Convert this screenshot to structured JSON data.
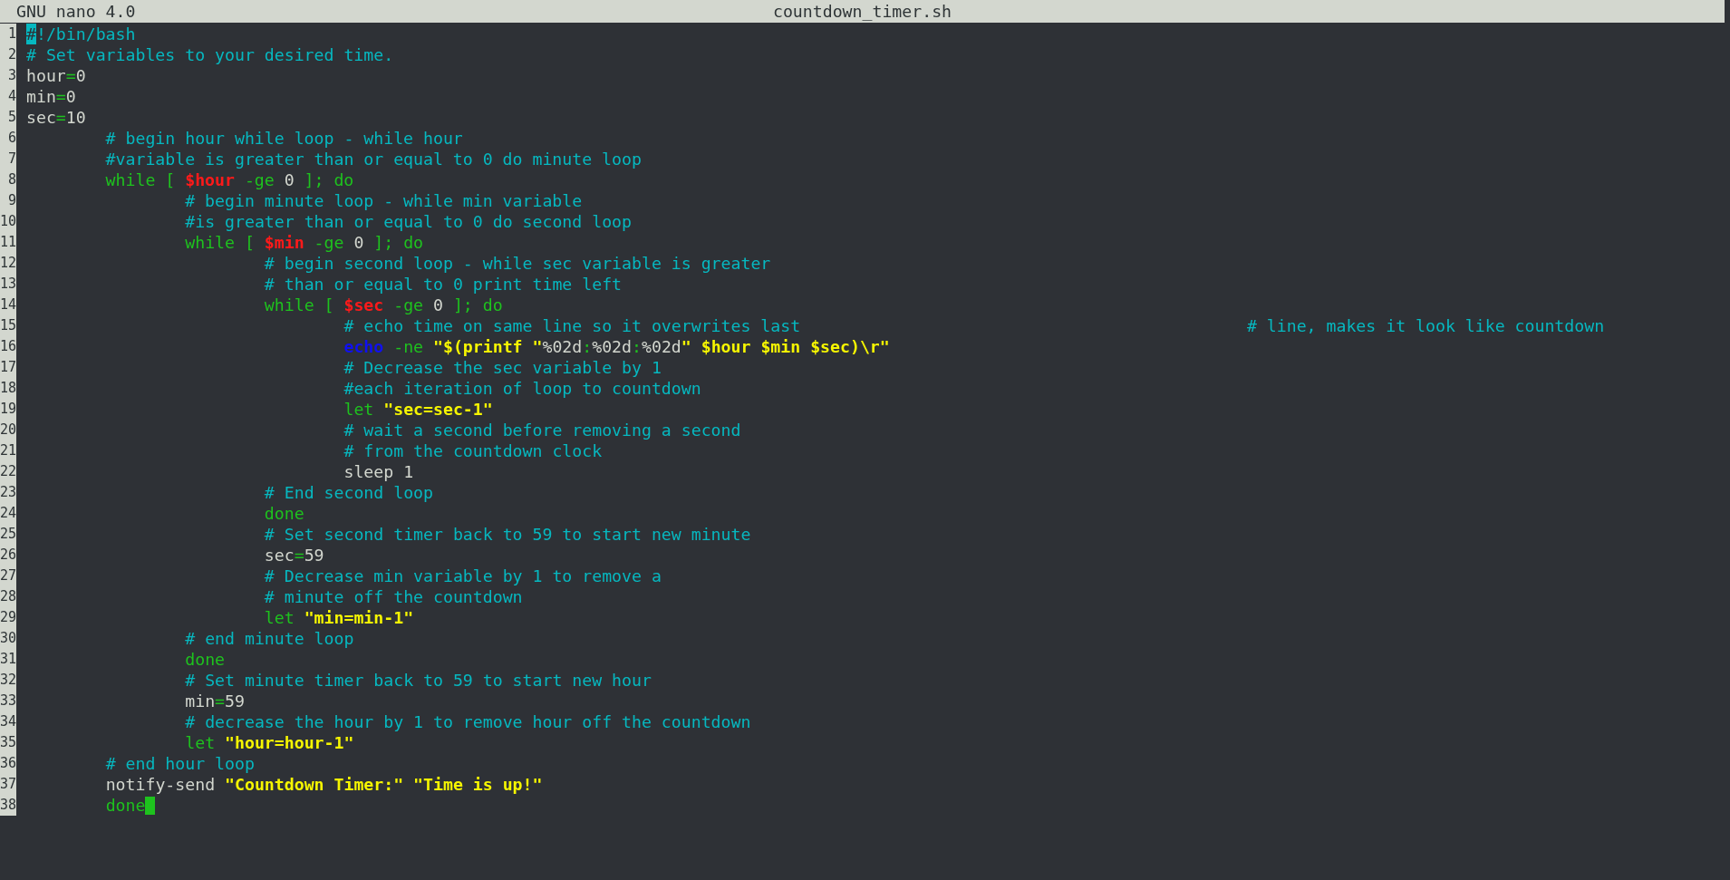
{
  "title_bar": {
    "app": "GNU nano 4.0",
    "file": "countdown_timer.sh"
  },
  "lines": [
    {
      "n": "1",
      "tokens": [
        {
          "kind": "highlight",
          "text": "#",
          "gap": false
        },
        {
          "kind": "comment",
          "text": "!/bin/bash",
          "gap": false
        }
      ]
    },
    {
      "n": "2",
      "tokens": [
        {
          "kind": "comment",
          "text": "# Set variables to your desired time.",
          "gap": false
        }
      ]
    },
    {
      "n": "3",
      "tokens": [
        {
          "kind": "plain",
          "text": "hour",
          "gap": false
        },
        {
          "kind": "keyword",
          "text": "=",
          "gap": false
        },
        {
          "kind": "plain",
          "text": "0",
          "gap": false
        }
      ]
    },
    {
      "n": "4",
      "tokens": [
        {
          "kind": "plain",
          "text": "min",
          "gap": false
        },
        {
          "kind": "keyword",
          "text": "=",
          "gap": false
        },
        {
          "kind": "plain",
          "text": "0",
          "gap": false
        }
      ]
    },
    {
      "n": "5",
      "tokens": [
        {
          "kind": "plain",
          "text": "sec",
          "gap": false
        },
        {
          "kind": "keyword",
          "text": "=",
          "gap": false
        },
        {
          "kind": "plain",
          "text": "10",
          "gap": false
        }
      ]
    },
    {
      "children": [
        {
          "n": "6",
          "tokens": [
            {
              "kind": "comment",
              "text": "# begin hour while loop - while hour",
              "gap": false
            }
          ]
        },
        {
          "n": "7",
          "tokens": [
            {
              "kind": "comment",
              "text": "#variable is greater than or equal to 0 do minute loop",
              "gap": false
            }
          ]
        },
        {
          "n": "8",
          "tokens": [
            {
              "kind": "keyword",
              "text": "while [",
              "gap": false
            },
            {
              "kind": "variable",
              "text": "$hour",
              "gap": true
            },
            {
              "kind": "keyword",
              "text": "-ge",
              "gap": true
            },
            {
              "kind": "plain",
              "text": "0",
              "gap": true
            },
            {
              "kind": "keyword",
              "text": "]; do",
              "gap": true
            }
          ],
          "children": [
            {
              "n": "9",
              "tokens": [
                {
                  "kind": "comment",
                  "text": "# begin minute loop - while min variable",
                  "gap": false
                }
              ]
            },
            {
              "n": "10",
              "tokens": [
                {
                  "kind": "comment",
                  "text": "#is greater than or equal to 0 do second loop",
                  "gap": false
                }
              ]
            },
            {
              "n": "11",
              "tokens": [
                {
                  "kind": "keyword",
                  "text": "while [",
                  "gap": false
                },
                {
                  "kind": "variable",
                  "text": "$min",
                  "gap": true
                },
                {
                  "kind": "keyword",
                  "text": "-ge",
                  "gap": true
                },
                {
                  "kind": "plain",
                  "text": "0",
                  "gap": true
                },
                {
                  "kind": "keyword",
                  "text": "]; do",
                  "gap": true
                }
              ],
              "children": [
                {
                  "n": "12",
                  "tokens": [
                    {
                      "kind": "comment",
                      "text": "# begin second loop - while sec variable is greater",
                      "gap": false
                    }
                  ]
                },
                {
                  "n": "13",
                  "tokens": [
                    {
                      "kind": "comment",
                      "text": "# than or equal to 0 print time left",
                      "gap": false
                    }
                  ]
                },
                {
                  "n": "14",
                  "tokens": [
                    {
                      "kind": "keyword",
                      "text": "while [",
                      "gap": false
                    },
                    {
                      "kind": "variable",
                      "text": "$sec",
                      "gap": true
                    },
                    {
                      "kind": "keyword",
                      "text": "-ge",
                      "gap": true
                    },
                    {
                      "kind": "plain",
                      "text": "0",
                      "gap": true
                    },
                    {
                      "kind": "keyword",
                      "text": "]; do",
                      "gap": true
                    }
                  ],
                  "children": [
                    {
                      "n": "15",
                      "tokens": [
                        {
                          "kind": "comment",
                          "text": "# echo time on same line so it overwrites last",
                          "gap": false
                        },
                        {
                          "kind": "far_comment",
                          "text": "# line, makes it look like countdown",
                          "gap": false
                        }
                      ]
                    },
                    {
                      "n": "16",
                      "tokens": [
                        {
                          "kind": "builtin",
                          "text": "echo",
                          "gap": false
                        },
                        {
                          "kind": "keyword",
                          "text": "-ne",
                          "gap": true
                        },
                        {
                          "kind": "string",
                          "text": "\"$(printf \"",
                          "gap": true
                        },
                        {
                          "kind": "plain",
                          "text": "%02d",
                          "gap": false
                        },
                        {
                          "kind": "keyword",
                          "text": ":",
                          "gap": false
                        },
                        {
                          "kind": "plain",
                          "text": "%02d",
                          "gap": false
                        },
                        {
                          "kind": "keyword",
                          "text": ":",
                          "gap": false
                        },
                        {
                          "kind": "plain",
                          "text": "%02d",
                          "gap": false
                        },
                        {
                          "kind": "string",
                          "text": "\" $hour $min $sec)\\r\"",
                          "gap": false
                        }
                      ]
                    },
                    {
                      "n": "17",
                      "tokens": [
                        {
                          "kind": "comment",
                          "text": "# Decrease the sec variable by 1",
                          "gap": false
                        }
                      ]
                    },
                    {
                      "n": "18",
                      "tokens": [
                        {
                          "kind": "comment",
                          "text": "#each iteration of loop to countdown",
                          "gap": false
                        }
                      ]
                    },
                    {
                      "n": "19",
                      "tokens": [
                        {
                          "kind": "keyword",
                          "text": "let",
                          "gap": false
                        },
                        {
                          "kind": "string",
                          "text": "\"sec=sec-1\"",
                          "gap": true
                        }
                      ]
                    },
                    {
                      "n": "20",
                      "tokens": [
                        {
                          "kind": "comment",
                          "text": "# wait a second before removing a second",
                          "gap": false
                        }
                      ]
                    },
                    {
                      "n": "21",
                      "tokens": [
                        {
                          "kind": "comment",
                          "text": "# from the countdown clock",
                          "gap": false
                        }
                      ]
                    },
                    {
                      "n": "22",
                      "tokens": [
                        {
                          "kind": "plain",
                          "text": "sleep 1",
                          "gap": false
                        }
                      ]
                    }
                  ]
                },
                {
                  "n": "23",
                  "tokens": [
                    {
                      "kind": "comment",
                      "text": "# End second loop",
                      "gap": false
                    }
                  ]
                },
                {
                  "n": "24",
                  "tokens": [
                    {
                      "kind": "keyword",
                      "text": "done",
                      "gap": false
                    }
                  ]
                },
                {
                  "n": "25",
                  "tokens": [
                    {
                      "kind": "comment",
                      "text": "# Set second timer back to 59 to start new minute",
                      "gap": false
                    }
                  ]
                },
                {
                  "n": "26",
                  "tokens": [
                    {
                      "kind": "plain",
                      "text": "sec",
                      "gap": false
                    },
                    {
                      "kind": "keyword",
                      "text": "=",
                      "gap": false
                    },
                    {
                      "kind": "plain",
                      "text": "59",
                      "gap": false
                    }
                  ]
                },
                {
                  "n": "27",
                  "tokens": [
                    {
                      "kind": "comment",
                      "text": "# Decrease min variable by 1 to remove a",
                      "gap": false
                    }
                  ]
                },
                {
                  "n": "28",
                  "tokens": [
                    {
                      "kind": "comment",
                      "text": "# minute off the countdown",
                      "gap": false
                    }
                  ]
                },
                {
                  "n": "29",
                  "tokens": [
                    {
                      "kind": "keyword",
                      "text": "let",
                      "gap": false
                    },
                    {
                      "kind": "string",
                      "text": "\"min=min-1\"",
                      "gap": true
                    }
                  ]
                }
              ]
            },
            {
              "n": "30",
              "tokens": [
                {
                  "kind": "comment",
                  "text": "# end minute loop",
                  "gap": false
                }
              ]
            },
            {
              "n": "31",
              "tokens": [
                {
                  "kind": "keyword",
                  "text": "done",
                  "gap": false
                }
              ]
            },
            {
              "n": "32",
              "tokens": [
                {
                  "kind": "comment",
                  "text": "# Set minute timer back to 59 to start new hour",
                  "gap": false
                }
              ]
            },
            {
              "n": "33",
              "tokens": [
                {
                  "kind": "plain",
                  "text": "min",
                  "gap": false
                },
                {
                  "kind": "keyword",
                  "text": "=",
                  "gap": false
                },
                {
                  "kind": "plain",
                  "text": "59",
                  "gap": false
                }
              ]
            },
            {
              "n": "34",
              "tokens": [
                {
                  "kind": "comment",
                  "text": "# decrease the hour by 1 to remove hour off the countdown",
                  "gap": false
                }
              ]
            },
            {
              "n": "35",
              "tokens": [
                {
                  "kind": "keyword",
                  "text": "let",
                  "gap": false
                },
                {
                  "kind": "string",
                  "text": "\"hour=hour-1\"",
                  "gap": true
                }
              ]
            }
          ]
        },
        {
          "n": "36",
          "tokens": [
            {
              "kind": "comment",
              "text": "# end hour loop",
              "gap": false
            }
          ]
        },
        {
          "n": "37",
          "tokens": [
            {
              "kind": "plain",
              "text": "notify-send",
              "gap": false
            },
            {
              "kind": "string",
              "text": "\"Countdown Timer:\"",
              "gap": true
            },
            {
              "kind": "string",
              "text": "\"Time is up!\"",
              "gap": true
            }
          ]
        },
        {
          "n": "38",
          "tokens": [
            {
              "kind": "keyword",
              "text": "done",
              "gap": false
            },
            {
              "kind": "cursor",
              "gap": false
            }
          ]
        }
      ]
    }
  ]
}
